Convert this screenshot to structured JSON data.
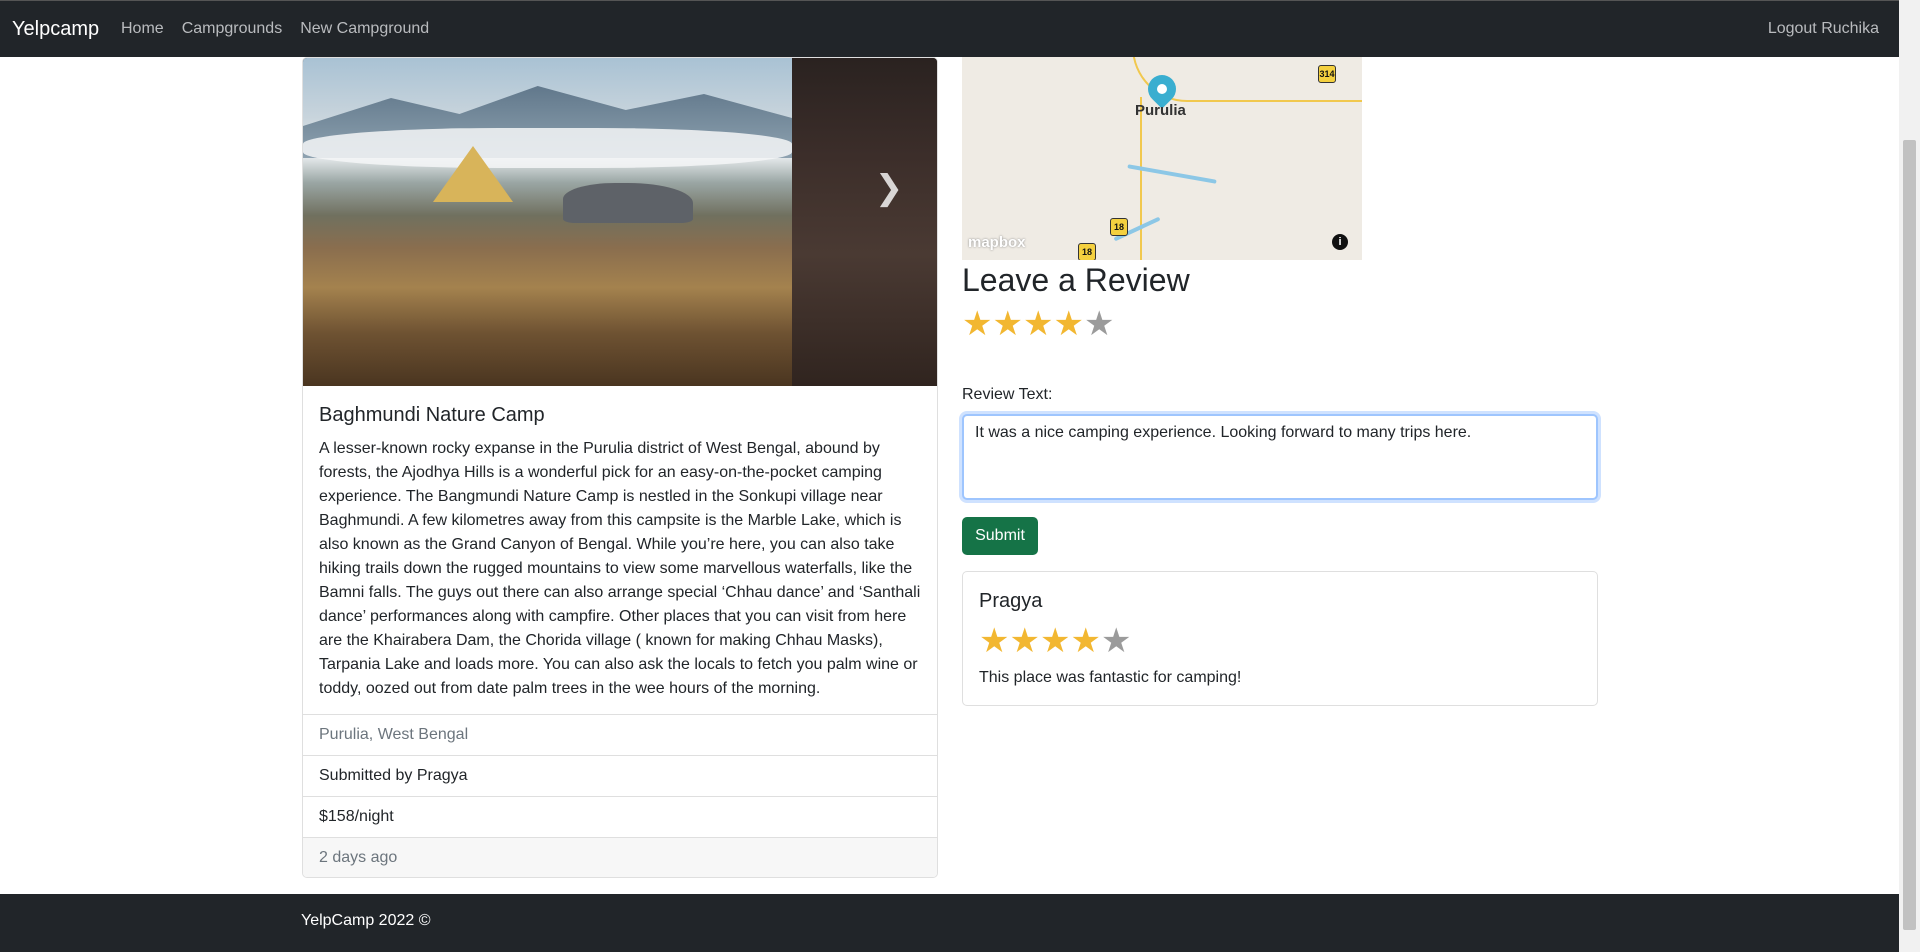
{
  "navbar": {
    "brand": "Yelpcamp",
    "links": [
      "Home",
      "Campgrounds",
      "New Campground"
    ],
    "logout": "Logout Ruchika"
  },
  "campground": {
    "title": "Baghmundi Nature Camp",
    "description": "A lesser-known rocky expanse in the Purulia district of West Bengal, abound by forests, the Ajodhya Hills is a wonderful pick for an easy-on-the-pocket camping experience. The Bangmundi Nature Camp is nestled in the Sonkupi village near Baghmundi. A few kilometres away from this campsite is the Marble Lake, which is also known as the Grand Canyon of Bengal. While you’re here, you can also take hiking trails down the rugged mountains to view some marvellous waterfalls, like the Bamni falls. The guys out there can also arrange special ‘Chhau dance’ and ‘Santhali dance’ performances along with campfire. Other places that you can visit from here are the Khairabera Dam, the Chorida village ( known for making Chhau Masks), Tarpania Lake and loads more. You can also ask the locals to fetch you palm wine or toddy, oozed out from date palm trees in the wee hours of the morning.",
    "location": "Purulia, West Bengal",
    "submitted_by": "Submitted by Pragya",
    "price": "$158/night",
    "posted": "2 days ago"
  },
  "map": {
    "city_label": "Purulia",
    "shields": [
      "314",
      "18",
      "18"
    ],
    "attribution": "mapbox",
    "info_icon": "i"
  },
  "review_form": {
    "heading": "Leave a Review",
    "rating": 4,
    "max_rating": 5,
    "label": "Review Text:",
    "text_value": "It was a nice camping experience. Looking forward to many trips here.",
    "submit_label": "Submit"
  },
  "reviews": [
    {
      "author": "Pragya",
      "rating": 4,
      "text": "This place was fantastic for camping!"
    }
  ],
  "footer": {
    "text": "YelpCamp 2022 ©"
  },
  "colors": {
    "navbar": "#212529",
    "submit": "#157347",
    "star_on": "#f2b731",
    "star_off": "#9b9b9b"
  }
}
